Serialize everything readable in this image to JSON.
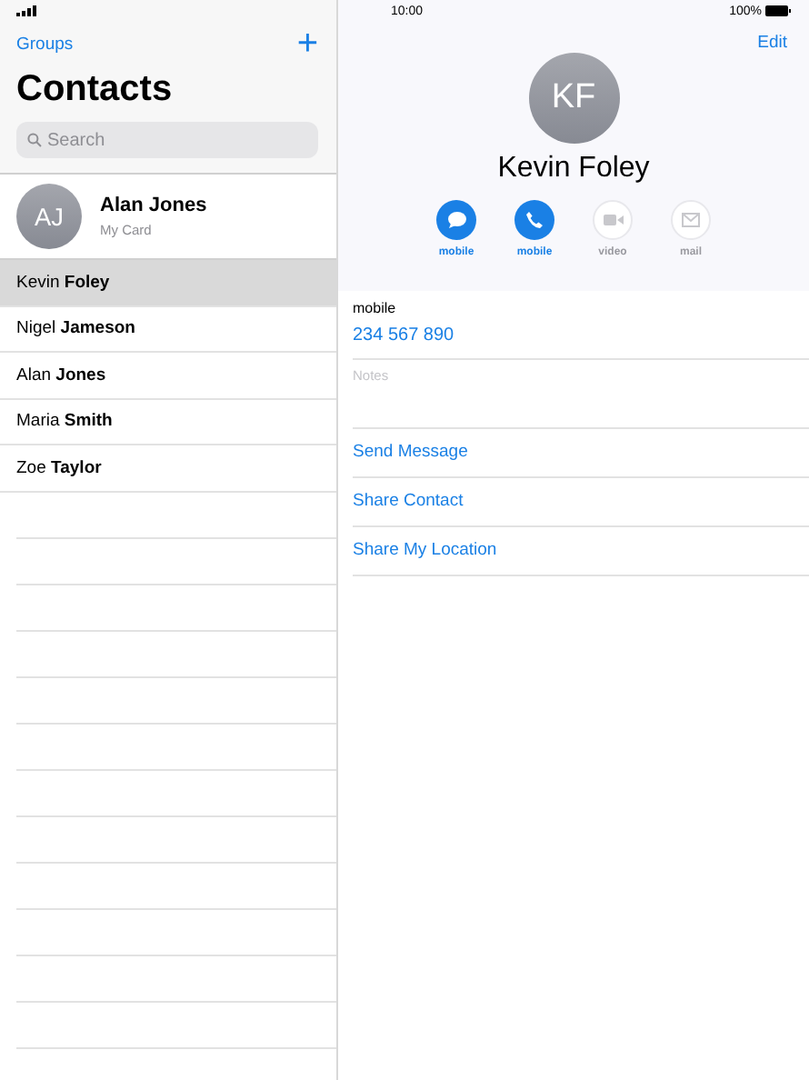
{
  "status_bar": {
    "time": "10:00",
    "battery": "100%"
  },
  "sidebar": {
    "groups_link": "Groups",
    "add_button": "+",
    "title": "Contacts",
    "search": {
      "placeholder": "Search"
    },
    "my_card": {
      "initials": "AJ",
      "name": "Alan Jones",
      "subtitle": "My Card"
    },
    "contacts": [
      {
        "name": "Kevin **Foley**",
        "selected": true
      },
      {
        "name": "Nigel **Jameson**",
        "selected": false
      },
      {
        "name": "Alan **Jones**",
        "selected": false
      },
      {
        "name": "Maria **Smith**",
        "selected": false
      },
      {
        "name": "Zoe **Taylor**",
        "selected": false
      }
    ]
  },
  "detail": {
    "edit_button": "Edit",
    "initials": "KF",
    "name": "Kevin Foley",
    "actions": [
      {
        "kind": "message",
        "label": "mobile",
        "disabled": false
      },
      {
        "kind": "phone",
        "label": "mobile",
        "disabled": false
      },
      {
        "kind": "video",
        "label": "video",
        "disabled": true
      },
      {
        "kind": "mail",
        "label": "mail",
        "disabled": true
      }
    ],
    "phone": {
      "label": "mobile",
      "number": "234 567 890"
    },
    "notes": {
      "placeholder": "Notes"
    },
    "links": [
      "Send Message",
      "Share Contact",
      "Share My Location"
    ]
  }
}
